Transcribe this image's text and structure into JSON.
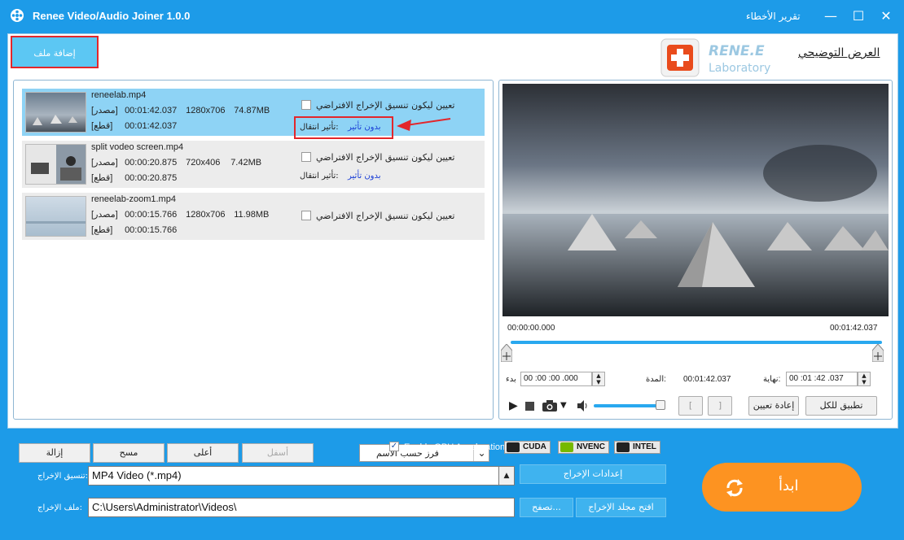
{
  "app": {
    "title": "Renee Video/Audio Joiner 1.0.0",
    "bug_report": "تقرير الأخطاء",
    "minimize": "—",
    "maximize": "☐",
    "close": "✕"
  },
  "toolbar": {
    "add_file": "إضافة ملف",
    "logo_top": "RENE.E",
    "logo_bottom": "Laboratory",
    "demo": "العرض التوضيحي"
  },
  "files": [
    {
      "name": "reneelab.mp4",
      "source_label": "[مصدر]",
      "source_time": "00:01:42.037",
      "resolution": "1280x706",
      "size": "74.87MB",
      "cut_label": "[قطع]",
      "cut_time": "00:01:42.037",
      "set_default": "تعيين ليكون تنسيق الإخراج الافتراضي",
      "transition_label": "تأثير انتقال:",
      "transition_value": "بدون تأثير"
    },
    {
      "name": "split vodeo screen.mp4",
      "source_label": "[مصدر]",
      "source_time": "00:00:20.875",
      "resolution": "720x406",
      "size": "7.42MB",
      "cut_label": "[قطع]",
      "cut_time": "00:00:20.875",
      "set_default": "تعيين ليكون تنسيق الإخراج الافتراضي",
      "transition_label": "تأثير انتقال:",
      "transition_value": "بدون تأثير"
    },
    {
      "name": "reneelab-zoom1.mp4",
      "source_label": "[مصدر]",
      "source_time": "00:00:15.766",
      "resolution": "1280x706",
      "size": "11.98MB",
      "cut_label": "[قطع]",
      "cut_time": "00:00:15.766",
      "set_default": "تعيين ليكون تنسيق الإخراج الافتراضي"
    }
  ],
  "list_buttons": {
    "remove": "إزالة",
    "clear": "مسح",
    "up": "أعلى",
    "down": "أسفل",
    "sort": "فرز حسب الاسم"
  },
  "preview": {
    "time_start": "00:00:00.000",
    "time_end": "00:01:42.037",
    "start_label": "بدء",
    "start_value": "00 :00 :00 .000",
    "duration_label": "المدة:",
    "duration_value": "00:01:42.037",
    "end_label": "نهاية:",
    "end_value": "00 :01 :42 .037",
    "reset": "إعادة تعيين",
    "apply_all": "تطبيق للكل",
    "mark_in": "[",
    "mark_out": "]",
    "volume_level": 0.85
  },
  "bottom": {
    "gpu_label": "Enable GPU Acceleration",
    "gpu_cuda": "CUDA",
    "gpu_nvenc": "NVENC",
    "gpu_intel": "INTEL",
    "format_label": "تنسيق الإخراج:",
    "format_value": "MP4 Video (*.mp4)",
    "output_settings": "إعدادات الإخراج",
    "folder_label": "ملف الإخراج:",
    "folder_value": "C:\\Users\\Administrator\\Videos\\",
    "browse": "تصفح...",
    "open_folder": "افتح مجلد الإخراج",
    "start": "ابدأ"
  },
  "colors": {
    "accent": "#1d9be8",
    "selected_row": "#8ed3f5",
    "start_button": "#fd9321",
    "highlight_border": "#e3262b"
  }
}
